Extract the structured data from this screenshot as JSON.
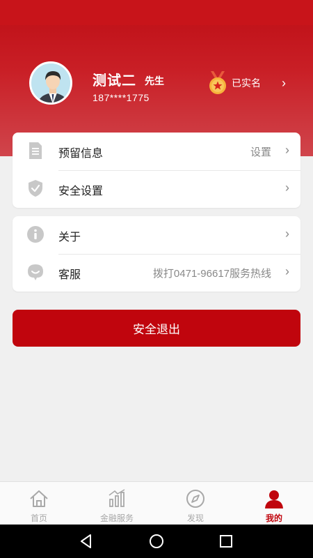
{
  "profile": {
    "name": "测试二",
    "title": "先生",
    "phone": "187****1775",
    "verify_label": "已实名"
  },
  "menu_group1": [
    {
      "label": "预留信息",
      "value": "设置",
      "icon": "document-icon"
    },
    {
      "label": "安全设置",
      "value": "",
      "icon": "shield-icon"
    }
  ],
  "menu_group2": [
    {
      "label": "关于",
      "value": "",
      "icon": "info-icon"
    },
    {
      "label": "客服",
      "value": "拨打0471-96617服务热线",
      "icon": "chat-bubble-icon"
    }
  ],
  "logout_label": "安全退出",
  "tabs": [
    {
      "label": "首页",
      "icon": "home-icon",
      "active": false
    },
    {
      "label": "金融服务",
      "icon": "bar-chart-icon",
      "active": false
    },
    {
      "label": "发现",
      "icon": "compass-icon",
      "active": false
    },
    {
      "label": "我的",
      "icon": "person-icon",
      "active": true
    }
  ],
  "colors": {
    "brand_red": "#c0050d",
    "header_top": "#bd0d14",
    "header_bottom": "#d0454c",
    "text_gray": "#888888",
    "inactive_tab": "#a8a8a8"
  }
}
